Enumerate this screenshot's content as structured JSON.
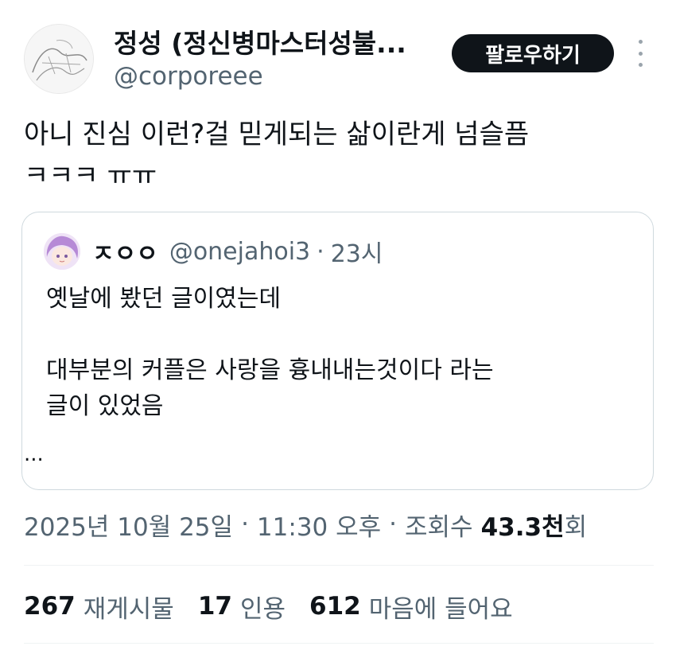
{
  "author": {
    "display_name": "정성 (정신병마스터성불...",
    "handle": "@corporeee",
    "avatar_icon": "sketch-avatar-icon"
  },
  "follow_button": {
    "label": "팔로우하기"
  },
  "more_menu_icon": "more-vertical-icon",
  "tweet": {
    "text": "아니 진심 이런?걸 믿게되는 삶이란게 넘슬픔\nㅋㅋㅋ ㅠㅠ"
  },
  "quote": {
    "avatar_icon": "anime-avatar-icon",
    "display_name": "ㅈㅇㅇ",
    "handle": "@onejahoi3",
    "separator": "·",
    "time": "23시",
    "body": "옛날에 봤던 글이였는데\n\n대부분의 커플은 사랑을 흉내내는것이다 라는\n글이 있었음",
    "ellipsis": "..."
  },
  "meta": {
    "date": "2025년 10월 25일",
    "sep1": "·",
    "time": "11:30 오후",
    "sep2": "·",
    "views_label": "조회수",
    "views_number": "43.3천",
    "views_suffix": "회"
  },
  "stats": {
    "reposts": {
      "count": "267",
      "label": "재게시물"
    },
    "quotes": {
      "count": "17",
      "label": "인용"
    },
    "likes": {
      "count": "612",
      "label": "마음에 들어요"
    }
  },
  "colors": {
    "text_primary": "#0f1419",
    "text_secondary": "#536471",
    "border": "#cfd9de",
    "button_bg": "#0f1419"
  }
}
